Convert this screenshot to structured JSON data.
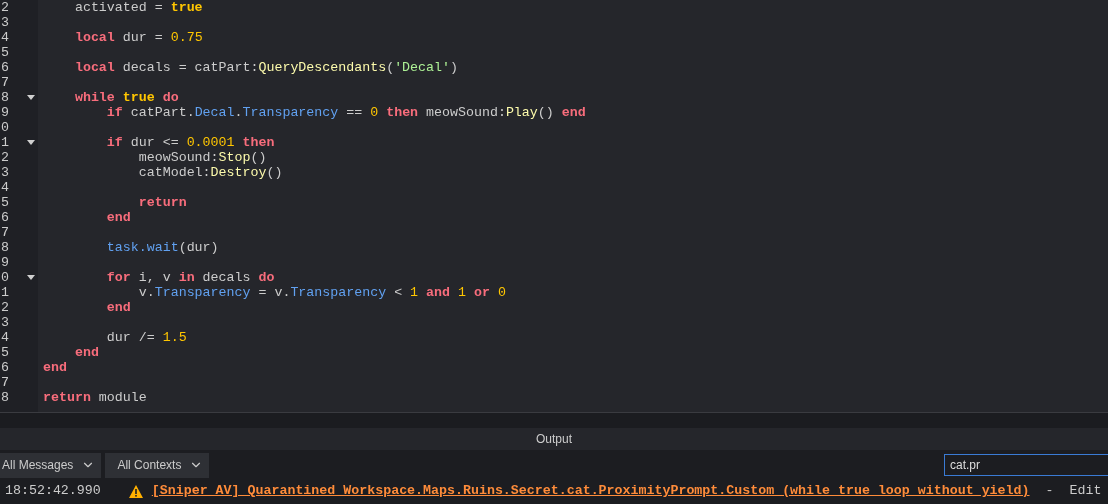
{
  "editor": {
    "lines": [
      {
        "number": "2",
        "fold": false,
        "tokens": [
          {
            "t": "    activated = ",
            "kind": "plain"
          },
          {
            "t": "true",
            "kind": "bool"
          }
        ]
      },
      {
        "number": "3",
        "fold": false
      },
      {
        "number": "4",
        "fold": false,
        "tokens": [
          {
            "t": "    local",
            "kind": "kw"
          },
          {
            "t": " dur = ",
            "kind": "plain"
          },
          {
            "t": "0.75",
            "kind": "num"
          }
        ]
      },
      {
        "number": "5",
        "fold": false
      },
      {
        "number": "6",
        "fold": false,
        "tokens": [
          {
            "t": "    local",
            "kind": "kw"
          },
          {
            "t": " decals = catPart:",
            "kind": "plain"
          },
          {
            "t": "QueryDescendants",
            "kind": "method"
          },
          {
            "t": "(",
            "kind": "plain"
          },
          {
            "t": "'Decal'",
            "kind": "str"
          },
          {
            "t": ")",
            "kind": "plain"
          }
        ]
      },
      {
        "number": "7",
        "fold": false
      },
      {
        "number": "8",
        "fold": true,
        "tokens": [
          {
            "t": "    while",
            "kind": "kw"
          },
          {
            "t": " true ",
            "kind": "bool"
          },
          {
            "t": "do",
            "kind": "kw"
          }
        ]
      },
      {
        "number": "9",
        "fold": false,
        "tokens": [
          {
            "t": "        if",
            "kind": "kw"
          },
          {
            "t": " catPart.",
            "kind": "plain"
          },
          {
            "t": "Decal",
            "kind": "prop"
          },
          {
            "t": ".",
            "kind": "plain"
          },
          {
            "t": "Transparency",
            "kind": "prop"
          },
          {
            "t": " == ",
            "kind": "plain"
          },
          {
            "t": "0 ",
            "kind": "num"
          },
          {
            "t": "then",
            "kind": "kw"
          },
          {
            "t": " meowSound:",
            "kind": "plain"
          },
          {
            "t": "Play",
            "kind": "method"
          },
          {
            "t": "() ",
            "kind": "plain"
          },
          {
            "t": "end",
            "kind": "kw"
          }
        ]
      },
      {
        "number": "0",
        "fold": false
      },
      {
        "number": "1",
        "fold": true,
        "tokens": [
          {
            "t": "        if",
            "kind": "kw"
          },
          {
            "t": " dur <= ",
            "kind": "plain"
          },
          {
            "t": "0.0001 ",
            "kind": "num"
          },
          {
            "t": "then",
            "kind": "kw"
          }
        ]
      },
      {
        "number": "2",
        "fold": false,
        "tokens": [
          {
            "t": "            meowSound:",
            "kind": "plain"
          },
          {
            "t": "Stop",
            "kind": "method"
          },
          {
            "t": "()",
            "kind": "plain"
          }
        ]
      },
      {
        "number": "3",
        "fold": false,
        "tokens": [
          {
            "t": "            catModel:",
            "kind": "plain"
          },
          {
            "t": "Destroy",
            "kind": "method"
          },
          {
            "t": "()",
            "kind": "plain"
          }
        ]
      },
      {
        "number": "4",
        "fold": false
      },
      {
        "number": "5",
        "fold": false,
        "tokens": [
          {
            "t": "            return",
            "kind": "kw"
          }
        ]
      },
      {
        "number": "6",
        "fold": false,
        "tokens": [
          {
            "t": "        end",
            "kind": "kw"
          }
        ]
      },
      {
        "number": "7",
        "fold": false
      },
      {
        "number": "8",
        "fold": false,
        "tokens": [
          {
            "t": "        task.wait",
            "kind": "prop"
          },
          {
            "t": "(dur)",
            "kind": "plain"
          }
        ]
      },
      {
        "number": "9",
        "fold": false
      },
      {
        "number": "0",
        "fold": true,
        "tokens": [
          {
            "t": "        for",
            "kind": "kw"
          },
          {
            "t": " i, v ",
            "kind": "plain"
          },
          {
            "t": "in",
            "kind": "kw"
          },
          {
            "t": " decals ",
            "kind": "plain"
          },
          {
            "t": "do",
            "kind": "kw"
          }
        ]
      },
      {
        "number": "1",
        "fold": false,
        "tokens": [
          {
            "t": "            v.",
            "kind": "plain"
          },
          {
            "t": "Transparency",
            "kind": "prop"
          },
          {
            "t": " = v.",
            "kind": "plain"
          },
          {
            "t": "Transparency",
            "kind": "prop"
          },
          {
            "t": " < ",
            "kind": "plain"
          },
          {
            "t": "1 ",
            "kind": "num"
          },
          {
            "t": "and",
            "kind": "kw"
          },
          {
            "t": " 1 ",
            "kind": "num"
          },
          {
            "t": "or",
            "kind": "kw"
          },
          {
            "t": " 0",
            "kind": "num"
          }
        ]
      },
      {
        "number": "2",
        "fold": false,
        "tokens": [
          {
            "t": "        end",
            "kind": "kw"
          }
        ]
      },
      {
        "number": "3",
        "fold": false
      },
      {
        "number": "4",
        "fold": false,
        "tokens": [
          {
            "t": "        dur /= ",
            "kind": "plain"
          },
          {
            "t": "1.5",
            "kind": "num"
          }
        ]
      },
      {
        "number": "5",
        "fold": false,
        "tokens": [
          {
            "t": "    end",
            "kind": "kw"
          }
        ]
      },
      {
        "number": "6",
        "fold": false,
        "tokens": [
          {
            "t": "end",
            "kind": "kw"
          }
        ]
      },
      {
        "number": "7",
        "fold": false
      },
      {
        "number": "8",
        "fold": false,
        "tokens": [
          {
            "t": "return",
            "kind": "kw"
          },
          {
            "t": " module",
            "kind": "plain"
          }
        ]
      }
    ]
  },
  "output": {
    "title": "Output",
    "filters": [
      {
        "label": "All Messages"
      },
      {
        "label": "All Contexts"
      }
    ],
    "search": {
      "value": "cat.pr"
    },
    "messages": [
      {
        "time": "18:52:42.990",
        "kind": "warning",
        "text": "[Sniper AV] Quarantined Workspace.Maps.Ruins.Secret.cat.ProximityPrompt.Custom (while true loop without yield)",
        "separator": "-",
        "action": "Edit"
      }
    ]
  }
}
